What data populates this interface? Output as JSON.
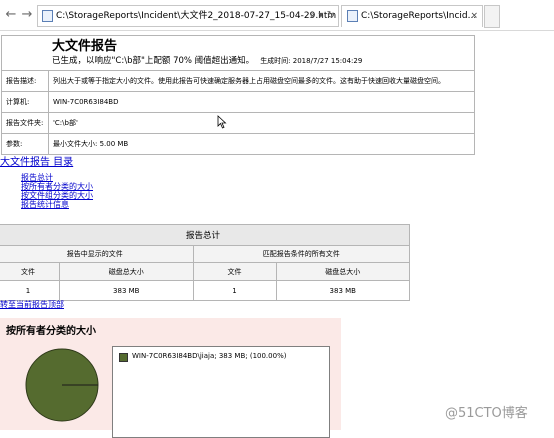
{
  "browser": {
    "address": "C:\\StorageReports\\Incident\\大文件2_2018-07-27_15-04-29.htm",
    "address_tools": "⌕ ▾ ↻",
    "tab_title": "C:\\StorageReports\\Incid...",
    "tab_close": "×"
  },
  "report": {
    "title": "大文件报告",
    "subtitle": "已生成，以响应\"C:\\b部\"上配额 70% 阈值超出通知。",
    "generated": "生成时间: 2018/7/27 15:04:29",
    "desc_label": "报告描述:",
    "desc_value": "列出大于或等于指定大小的文件。使用此报告可快速确定服务器上占用磁盘空间最多的文件。这有助于快速回收大量磁盘空间。",
    "computer_label": "计算机:",
    "computer_value": "WIN-7C0R63I84BD",
    "folder_label": "报告文件夹:",
    "folder_value": "'C:\\b部'",
    "param_label": "参数:",
    "param_value": "最小文件大小: 5.00 MB"
  },
  "toc": {
    "title": "大文件报告 目录",
    "items": [
      "报告总计",
      "按所有者分类的大小",
      "按文件组分类的大小",
      "报告统计信息"
    ]
  },
  "summary": {
    "caption": "报告总计",
    "group_shown": "报告中显示的文件",
    "group_all": "匹配报告条件的所有文件",
    "col_files": "文件",
    "col_size": "磁盘总大小",
    "shown_files": "1",
    "shown_size": "383 MB",
    "all_files": "1",
    "all_size": "383 MB"
  },
  "back_to_top": "转至当前报告顶部",
  "owner_section": {
    "title": "按所有者分类的大小",
    "legend_item": "WIN-7C0R63I84BD\\jiaja; 383 MB; (100.00%)",
    "slice_color": "#556b2f"
  },
  "watermark": "@51CTO博客"
}
